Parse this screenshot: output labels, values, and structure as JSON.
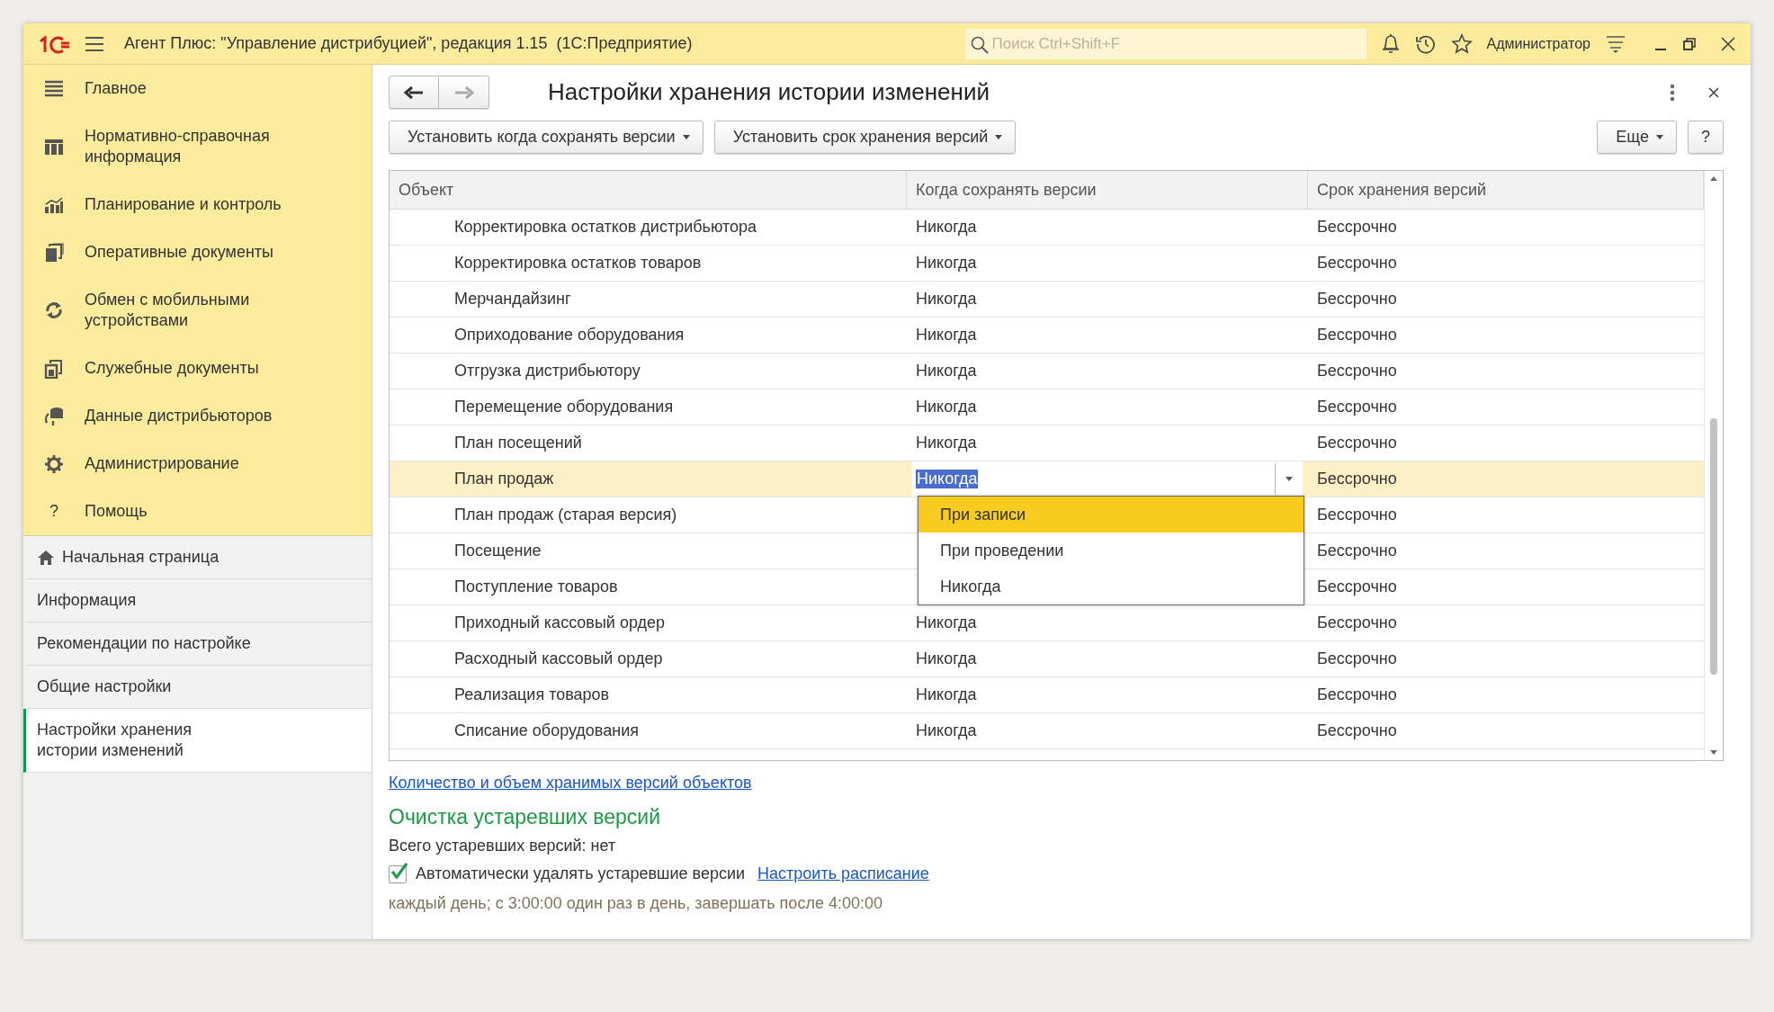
{
  "window": {
    "title": "Агент Плюс: \"Управление дистрибуцией\", редакция 1.15  (1С:Предприятие)",
    "search": {
      "placeholder": "Поиск Ctrl+Shift+F"
    },
    "user": "Администратор"
  },
  "sections": [
    {
      "label": "Главное"
    },
    {
      "label": "Нормативно-справочная информация"
    },
    {
      "label": "Планирование и контроль"
    },
    {
      "label": "Оперативные документы"
    },
    {
      "label": "Обмен с мобильными устройствами"
    },
    {
      "label": "Служебные документы"
    },
    {
      "label": "Данные дистрибьюторов"
    },
    {
      "label": "Администрирование"
    },
    {
      "label": "Помощь",
      "icon_text": "?"
    }
  ],
  "nav": [
    {
      "label": "Начальная страница",
      "selected": false
    },
    {
      "label": "Информация",
      "selected": false
    },
    {
      "label": "Рекомендации по настройке",
      "selected": false
    },
    {
      "label": "Общие настройки",
      "selected": false
    },
    {
      "label": "Настройки хранения истории изменений",
      "selected": true
    }
  ],
  "form": {
    "title": "Настройки хранения истории изменений",
    "buttons": [
      "Установить когда сохранять версии",
      "Установить срок хранения версий"
    ],
    "more": "Еще",
    "help": "?",
    "columns": [
      "Объект",
      "Когда сохранять версии",
      "Срок хранения версий"
    ],
    "rows": [
      {
        "object": "Корректировка остатков дистрибьютора",
        "when": "Никогда",
        "period": "Бессрочно",
        "selected": false
      },
      {
        "object": "Корректировка остатков товаров",
        "when": "Никогда",
        "period": "Бессрочно",
        "selected": false
      },
      {
        "object": "Мерчандайзинг",
        "when": "Никогда",
        "period": "Бессрочно",
        "selected": false
      },
      {
        "object": "Оприходование оборудования",
        "when": "Никогда",
        "period": "Бессрочно",
        "selected": false
      },
      {
        "object": "Отгрузка дистрибьютору",
        "when": "Никогда",
        "period": "Бессрочно",
        "selected": false
      },
      {
        "object": "Перемещение оборудования",
        "when": "Никогда",
        "period": "Бессрочно",
        "selected": false
      },
      {
        "object": "План посещений",
        "when": "Никогда",
        "period": "Бессрочно",
        "selected": false
      },
      {
        "object": "План продаж",
        "when": "Никогда",
        "period": "Бессрочно",
        "selected": true
      },
      {
        "object": "План продаж (старая версия)",
        "period": "Бессрочно",
        "selected": false
      },
      {
        "object": "Посещение",
        "period": "Бессрочно",
        "selected": false
      },
      {
        "object": "Поступление товаров",
        "period": "Бессрочно",
        "selected": false
      },
      {
        "object": "Приходный кассовый ордер",
        "when": "Никогда",
        "period": "Бессрочно",
        "selected": false
      },
      {
        "object": "Расходный кассовый ордер",
        "when": "Никогда",
        "period": "Бессрочно",
        "selected": false
      },
      {
        "object": "Реализация товаров",
        "when": "Никогда",
        "period": "Бессрочно",
        "selected": false
      },
      {
        "object": "Списание оборудования",
        "when": "Никогда",
        "period": "Бессрочно",
        "selected": false
      }
    ],
    "dropdown": [
      {
        "label": "При записи",
        "selected": true
      },
      {
        "label": "При проведении",
        "selected": false
      },
      {
        "label": "Никогда",
        "selected": false
      }
    ],
    "link": "Количество и объем хранимых версий объектов",
    "cleanup": {
      "heading": "Очистка устаревших версий",
      "total": "Всего устаревших версий: нет",
      "auto_delete": {
        "label": "Автоматически удалять устаревшие версии",
        "checked": true
      },
      "schedule_link": "Настроить расписание",
      "schedule": "каждый день; с 3:00:00 один раз в день, завершать после 4:00:00"
    }
  }
}
